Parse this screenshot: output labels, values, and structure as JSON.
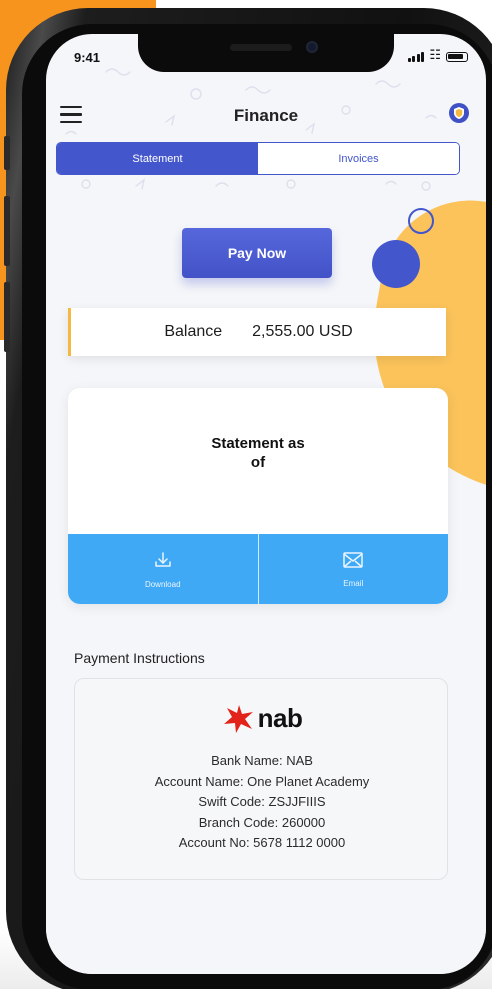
{
  "status_bar": {
    "time": "9:41"
  },
  "header": {
    "title": "Finance"
  },
  "tabs": [
    {
      "label": "Statement",
      "active": true
    },
    {
      "label": "Invoices",
      "active": false
    }
  ],
  "pay_button": {
    "label": "Pay Now"
  },
  "balance": {
    "label": "Balance",
    "value": "2,555.00 USD"
  },
  "statement": {
    "title_line1": "Statement as",
    "title_line2": "of",
    "actions": [
      {
        "label": "Download",
        "icon": "download-icon"
      },
      {
        "label": "Email",
        "icon": "email-icon"
      }
    ]
  },
  "payment_instructions": {
    "heading": "Payment Instructions",
    "logo_text": "nab",
    "details": [
      "Bank Name: NAB",
      "Account Name: One Planet Academy",
      "Swift Code: ZSJJFIIIS",
      "Branch Code: 260000",
      "Account No: 5678 1112 0000"
    ]
  },
  "colors": {
    "accent": "#4356cc",
    "action_blue": "#40a9f5",
    "yellow": "#fbc35a",
    "orange_background": "#f7941d",
    "nab_red": "#e2231a"
  }
}
